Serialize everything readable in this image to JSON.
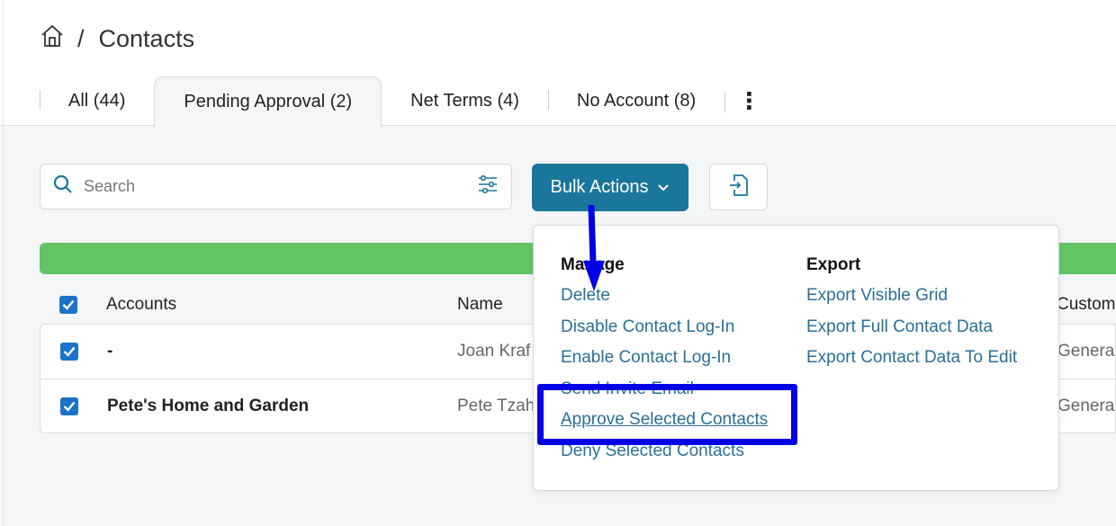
{
  "breadcrumb": {
    "home_icon": "home-icon",
    "separator": "/",
    "title": "Contacts"
  },
  "tabs": [
    {
      "label": "All (44)"
    },
    {
      "label": "Pending Approval (2)",
      "active": true
    },
    {
      "label": "Net Terms (4)"
    },
    {
      "label": "No Account (8)"
    }
  ],
  "search": {
    "placeholder": "Search",
    "value": ""
  },
  "toolbar": {
    "bulk_actions_label": "Bulk Actions"
  },
  "table": {
    "headers": [
      "Accounts",
      "Name",
      "Custom"
    ],
    "rows": [
      {
        "account": "-",
        "name": "Joan Kraf",
        "custom": "Genera",
        "checked": true
      },
      {
        "account": "Pete's Home and Garden",
        "name": "Pete Tzah",
        "custom": "Genera",
        "checked": true
      }
    ],
    "select_all_checked": true
  },
  "bulk_menu": {
    "manage": {
      "title": "Manage",
      "items": [
        "Delete",
        "Disable Contact Log-In",
        "Enable Contact Log-In",
        "Send Invite Email",
        "Approve Selected Contacts",
        "Deny Selected Contacts"
      ]
    },
    "export": {
      "title": "Export",
      "items": [
        "Export Visible Grid",
        "Export Full Contact Data",
        "Export Contact Data To Edit"
      ]
    },
    "highlighted": "Approve Selected Contacts"
  },
  "colors": {
    "primary": "#1b769c",
    "success_bar": "#63c466",
    "link": "#2a6f97",
    "annotation": "#0000e6"
  }
}
